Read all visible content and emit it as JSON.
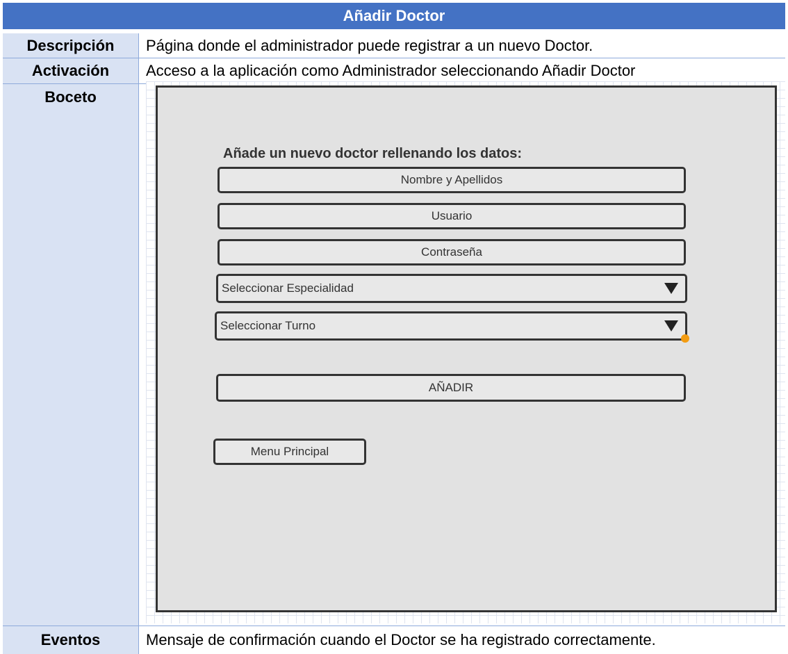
{
  "table": {
    "title": "Añadir Doctor",
    "rows": {
      "descripcion": {
        "label": "Descripción",
        "value": "Página donde el administrador puede registrar a un nuevo Doctor."
      },
      "activacion": {
        "label": "Activación",
        "value": "Acceso a la aplicación como Administrador seleccionando Añadir Doctor"
      },
      "boceto": {
        "label": "Boceto"
      },
      "eventos": {
        "label": "Eventos",
        "value": "Mensaje de confirmación cuando el Doctor se ha registrado correctamente."
      }
    },
    "colors": {
      "header": "#4472c4",
      "label_column": "#d9e2f3",
      "border": "#8eaadb"
    }
  },
  "mockup": {
    "heading": "Añade un nuevo doctor rellenando los datos:",
    "fields": {
      "nombre": "Nombre y Apellidos",
      "usuario": "Usuario",
      "contrasena": "Contraseña"
    },
    "selects": {
      "especialidad": "Seleccionar Especialidad",
      "turno": "Seleccionar Turno"
    },
    "buttons": {
      "anadir": "AÑADIR",
      "menu": "Menu Principal"
    },
    "colors": {
      "screen_bg": "#e2e2e2",
      "stroke": "#333333",
      "marker": "#f39c12"
    }
  }
}
